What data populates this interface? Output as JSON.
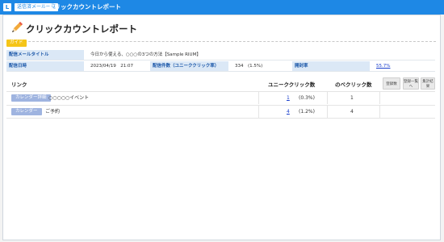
{
  "topbar": {
    "logo_text": "L",
    "breadcrumb": "送信済メール一覧",
    "separator": "»",
    "title": "クリックカウントレポート"
  },
  "page": {
    "title": "クリックカウントレポート",
    "guide_label": "ガイド"
  },
  "info": {
    "subject_label": "配信メールタイトル",
    "subject_value": "今日から使える、○○○の3つの方法【Sample RIUM】",
    "date_label": "配信日時",
    "date_value": "2023/04/19　21:07",
    "count_label": "配信件数（ユニーククリック率）",
    "count_value": "334　(1.5%)",
    "open_label": "開封率",
    "open_value": "55.7%"
  },
  "list": {
    "columns": {
      "link": "リンク",
      "unique": "ユニーククリック数",
      "total": "のべクリック数"
    },
    "buttons": {
      "register": "登録数",
      "register_list": "登録一覧へ",
      "summary": "集計結果"
    },
    "rows": [
      {
        "tag": "カレンダー詳細",
        "name": "○○○○○イベント",
        "unique": "1",
        "unique_pct": "(0.3%)",
        "total": "1"
      },
      {
        "tag": "カレンダー",
        "name": "ご予約",
        "unique": "4",
        "unique_pct": "(1.2%)",
        "total": "4"
      }
    ]
  },
  "colors": {
    "topbar": "#1e88e5",
    "label_bg": "#dbe8f6",
    "tag_bg": "#9fb4e0",
    "guide_bg": "#f5c518"
  }
}
